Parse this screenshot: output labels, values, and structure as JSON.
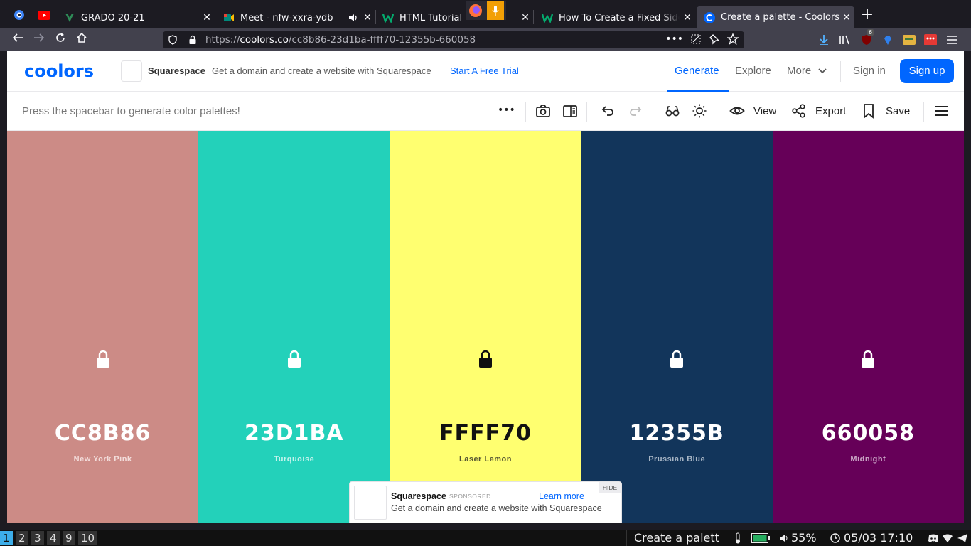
{
  "browser": {
    "pinned": [
      {
        "name": "circle-app-icon",
        "color": "#3b82f6"
      },
      {
        "name": "youtube-icon",
        "color": "#ff0000"
      }
    ],
    "tabs": [
      {
        "title": "GRADO 20-21",
        "favicon": "vue-green-icon",
        "color": "#2e8b57",
        "close": "✕"
      },
      {
        "title": "Meet - nfw-xxra-ydb",
        "favicon": "google-meet-icon",
        "color": "#00897b",
        "close": "✕"
      },
      {
        "title": "HTML Tutorial",
        "favicon": "w3schools-icon",
        "color": "#04aa6d",
        "close": "✕"
      },
      {
        "title": "How To Create a Fixed Sidebar",
        "favicon": "w3schools-icon",
        "color": "#04aa6d",
        "close": "✕"
      },
      {
        "title": "Create a palette - Coolors",
        "favicon": "coolors-icon",
        "color": "#0066ff",
        "close": "✕"
      }
    ],
    "new_tab": "+",
    "url_prefix": "https://",
    "url_host": "coolors.co",
    "url_path": "/cc8b86-23d1ba-ffff70-12355b-660058",
    "url_more": "•••",
    "extension_badge": "6"
  },
  "site": {
    "logo": "coolors",
    "ad_brand": "Squarespace",
    "ad_text": "Get a domain and create a website with Squarespace",
    "ad_cta": "Start A Free Trial",
    "nav": {
      "generate": "Generate",
      "explore": "Explore",
      "more": "More",
      "signin": "Sign in",
      "signup": "Sign up"
    },
    "accent": "#0066ff"
  },
  "toolbar": {
    "hint": "Press the spacebar to generate color palettes!",
    "more": "•••",
    "view": "View",
    "export": "Export",
    "save": "Save"
  },
  "palette": [
    {
      "hex": "CC8B86",
      "name": "New York Pink",
      "color": "#cc8b86",
      "text_color": "#ffffff",
      "name_color": "#f3dddb"
    },
    {
      "hex": "23D1BA",
      "name": "Turquoise",
      "color": "#23d1ba",
      "text_color": "#ffffff",
      "name_color": "#c7f3ed"
    },
    {
      "hex": "FFFF70",
      "name": "Laser Lemon",
      "color": "#ffff70",
      "text_color": "#111111",
      "name_color": "#555533"
    },
    {
      "hex": "12355B",
      "name": "Prussian Blue",
      "color": "#12355b",
      "text_color": "#ffffff",
      "name_color": "#a8b6c6"
    },
    {
      "hex": "660058",
      "name": "Midnight",
      "color": "#660058",
      "text_color": "#ffffff",
      "name_color": "#c9a3c4"
    }
  ],
  "sponsor": {
    "brand": "Squarespace",
    "tag": "SPONSORED",
    "cta": "Learn more",
    "hide": "HIDE",
    "desc": "Get a domain and create a website with Squarespace"
  },
  "wm": {
    "workspaces": [
      "1",
      "2",
      "3",
      "4",
      "9",
      "10"
    ],
    "active_workspace": "1",
    "window_title": "Create a palett",
    "volume": "55%",
    "datetime": "05/03 17:10"
  }
}
